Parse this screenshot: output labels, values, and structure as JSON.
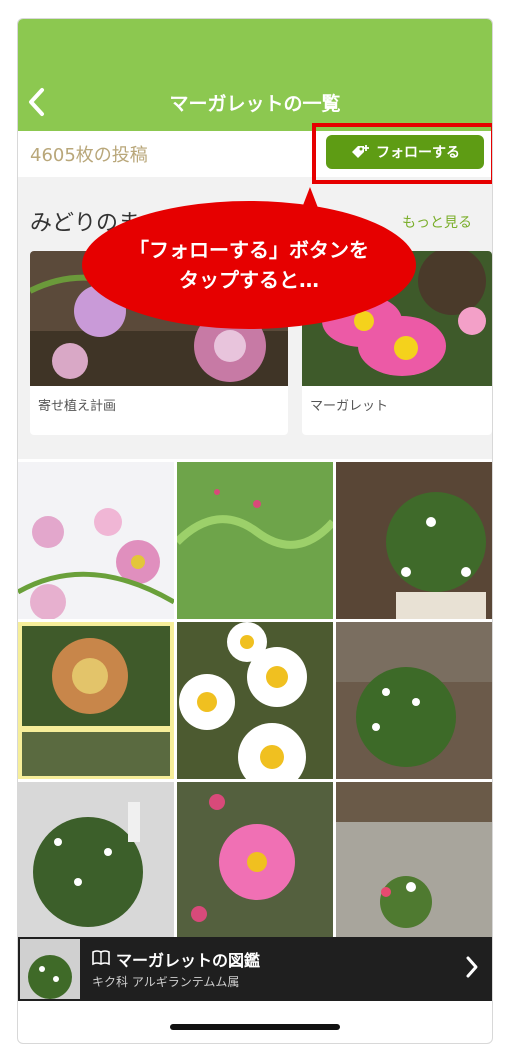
{
  "header": {
    "title": "マーガレットの一覧",
    "back_icon": "chevron-left-icon"
  },
  "posts": {
    "count_text": "4605枚の投稿"
  },
  "follow_button": {
    "label": "フォローする",
    "icon": "tag-plus-icon"
  },
  "section": {
    "title": "みどりのま",
    "more_label": "もっと見る",
    "cards": [
      {
        "caption": "寄せ植え計画"
      },
      {
        "caption": "マーガレット"
      }
    ]
  },
  "annotation": {
    "line1": "「フォローする」ボタンを",
    "line2": "タップすると…"
  },
  "zukan": {
    "title": "マーガレットの図鑑",
    "subtitle": "キク科 アルギランテムム属",
    "icon": "book-icon",
    "chevron": "chevron-right-icon"
  },
  "colors": {
    "header_green": "#8cc850",
    "follow_green": "#5e9c14",
    "highlight_red": "#e60000"
  }
}
